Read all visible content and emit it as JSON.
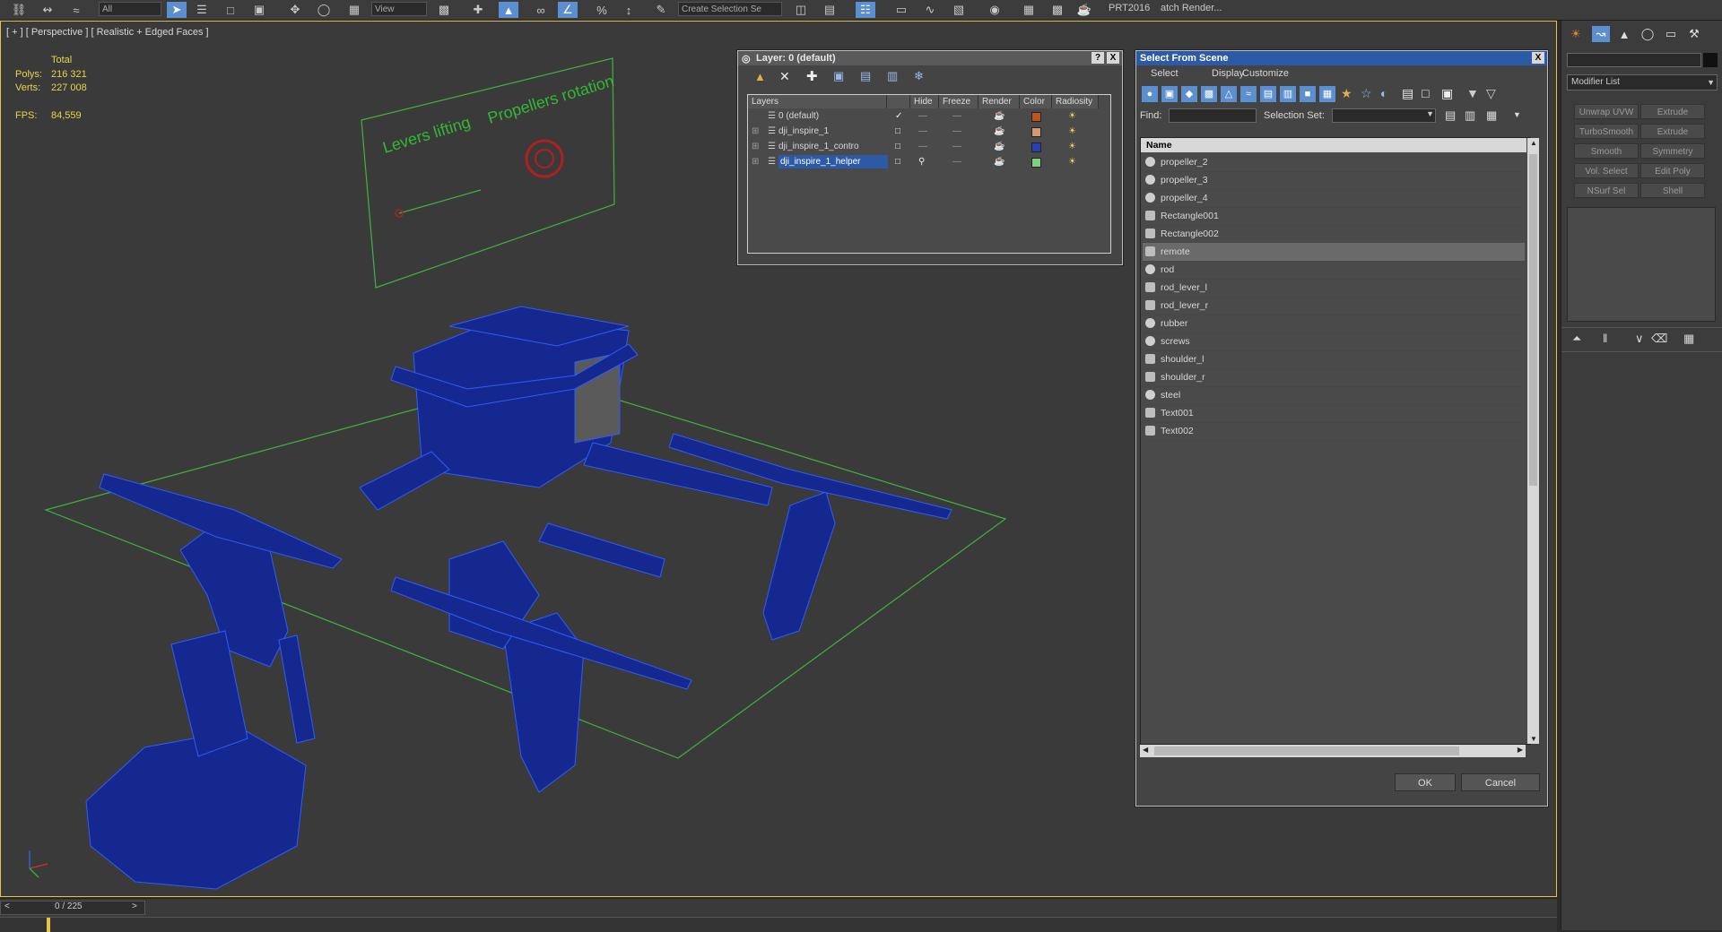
{
  "toolbar": {
    "select_box_value": "All",
    "view_value": "View",
    "named_selection_placeholder": "Create Selection Se",
    "prt_label": "PRT2016",
    "batch_render_label": "atch Render..."
  },
  "viewport": {
    "label": "[ + ] [ Perspective ] [ Realistic + Edged Faces ]",
    "stats": {
      "total_label": "Total",
      "polys_label": "Polys:",
      "polys_value": "216 321",
      "verts_label": "Verts:",
      "verts_value": "227 008",
      "fps_label": "FPS:",
      "fps_value": "84,559"
    },
    "scene_text": {
      "levers": "Levers lifting",
      "propellers": "Propellers rotation"
    }
  },
  "layer_window": {
    "title": "Layer: 0 (default)",
    "help_label": "?",
    "close_label": "X",
    "columns": [
      "Layers",
      "Hide",
      "Freeze",
      "Render",
      "Color",
      "Radiosity"
    ],
    "rows": [
      {
        "name": "0 (default)",
        "color": "#c0541e"
      },
      {
        "name": "dji_inspire_1",
        "color": "#d09a72"
      },
      {
        "name": "dji_inspire_1_contro",
        "color": "#2a3fb0"
      },
      {
        "name": "dji_inspire_1_helper",
        "color": "#7fd07a"
      }
    ]
  },
  "select_from_scene": {
    "title": "Select From Scene",
    "menu": [
      "Select",
      "Display",
      "Customize"
    ],
    "find_label": "Find:",
    "selection_set_label": "Selection Set:",
    "column_name": "Name",
    "items": [
      {
        "name": "propeller_2",
        "icon": "geometry-icon"
      },
      {
        "name": "propeller_3",
        "icon": "geometry-icon"
      },
      {
        "name": "propeller_4",
        "icon": "geometry-icon"
      },
      {
        "name": "Rectangle001",
        "icon": "shape-icon"
      },
      {
        "name": "Rectangle002",
        "icon": "shape-icon"
      },
      {
        "name": "remote",
        "icon": "shape-icon"
      },
      {
        "name": "rod",
        "icon": "geometry-icon"
      },
      {
        "name": "rod_lever_l",
        "icon": "shape-icon"
      },
      {
        "name": "rod_lever_r",
        "icon": "shape-icon"
      },
      {
        "name": "rubber",
        "icon": "geometry-icon"
      },
      {
        "name": "screws",
        "icon": "geometry-icon"
      },
      {
        "name": "shoulder_l",
        "icon": "shape-icon"
      },
      {
        "name": "shoulder_r",
        "icon": "shape-icon"
      },
      {
        "name": "steel",
        "icon": "geometry-icon"
      },
      {
        "name": "Text001",
        "icon": "shape-icon"
      },
      {
        "name": "Text002",
        "icon": "shape-icon"
      }
    ],
    "selected_item": "remote",
    "ok_label": "OK",
    "cancel_label": "Cancel"
  },
  "command_panel": {
    "modifier_list_label": "Modifier List",
    "modifier_buttons": [
      "Unwrap UVW",
      "Extrude",
      "TurboSmooth",
      "Extrude",
      "Smooth",
      "Symmetry",
      "Vol. Select",
      "Edit Poly",
      "NSurf Sel",
      "Shell"
    ]
  },
  "timeline": {
    "frame_counter": "0 / 225",
    "prev_label": "<",
    "next_label": ">"
  },
  "colors": {
    "accent_blue": "#2c5aa6",
    "viewport_border": "#e6c44a",
    "stat_text": "#e8d64a",
    "wire_blue": "#1a3fc8",
    "helper_green": "#3fb33f"
  }
}
